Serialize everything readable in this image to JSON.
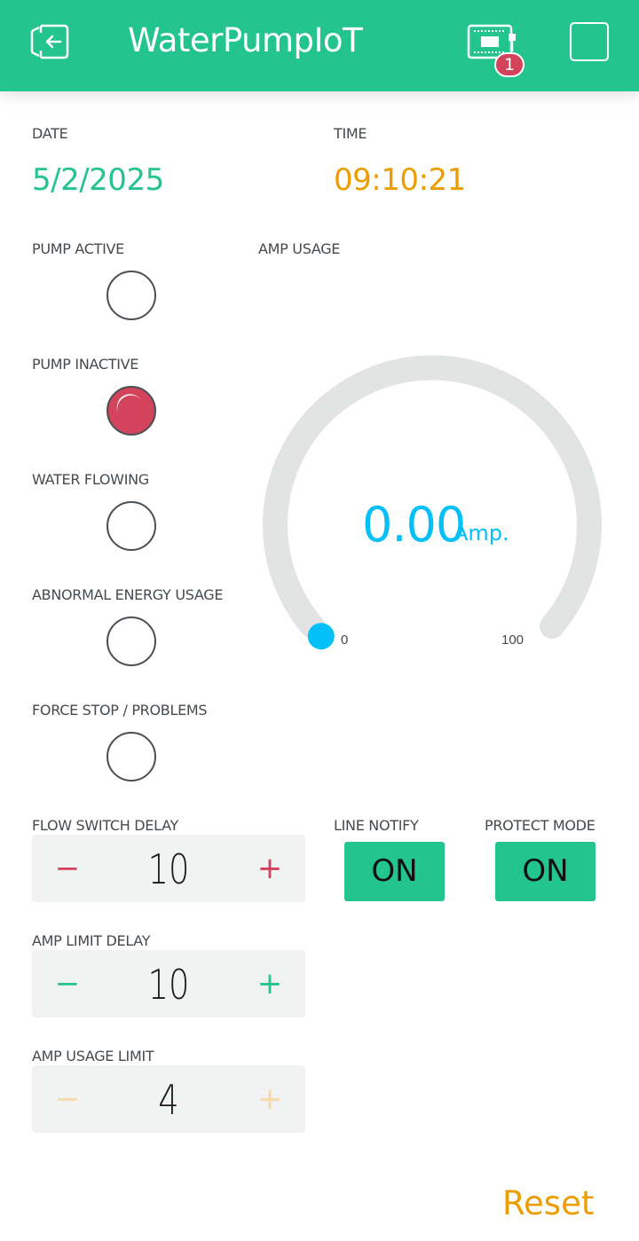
{
  "app": {
    "title": "WaterPumpIoT",
    "notification_count": "1"
  },
  "colors": {
    "brand": "#23c48e",
    "date": "#23c48e",
    "time": "#ed9d00",
    "gauge": "#04c0f8",
    "led_on": "#d3435c",
    "reset": "#ed9d00"
  },
  "date": {
    "label": "DATE",
    "value": "5/2/2025"
  },
  "time": {
    "label": "TIME",
    "value": "09:10:21"
  },
  "leds": [
    {
      "label": "PUMP ACTIVE",
      "on": false
    },
    {
      "label": "PUMP INACTIVE",
      "on": true
    },
    {
      "label": "WATER FLOWING",
      "on": false
    },
    {
      "label": "ABNORMAL ENERGY USAGE",
      "on": false
    },
    {
      "label": "FORCE STOP / PROBLEMS",
      "on": false
    }
  ],
  "gauge": {
    "label": "AMP USAGE",
    "value": "0.00",
    "unit": "Amp.",
    "min": "0",
    "max": "100",
    "level": 0
  },
  "steppers": [
    {
      "label": "FLOW SWITCH DELAY",
      "value": "10",
      "minus": "−",
      "plus": "+",
      "minus_color": "#d3435c",
      "plus_color": "#d3435c"
    },
    {
      "label": "AMP LIMIT DELAY",
      "value": "10",
      "minus": "−",
      "plus": "+",
      "minus_color": "#23c48e",
      "plus_color": "#23c48e"
    },
    {
      "label": "AMP USAGE LIMIT",
      "value": "4",
      "minus": "−",
      "plus": "+",
      "minus_color": "#f5d9a8",
      "plus_color": "#f5d9a8"
    }
  ],
  "switches": [
    {
      "label": "LINE NOTIFY",
      "value": "ON"
    },
    {
      "label": "PROTECT MODE",
      "value": "ON"
    }
  ],
  "reset": {
    "label": "Reset"
  },
  "icons": {
    "back": "exit-icon",
    "device": "device-icon",
    "menu": "square-icon"
  }
}
